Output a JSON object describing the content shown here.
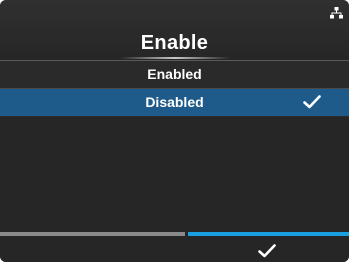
{
  "header": {
    "title": "Enable",
    "status_icon": "network-icon"
  },
  "list": {
    "items": [
      {
        "label": "Enabled",
        "selected": false
      },
      {
        "label": "Disabled",
        "selected": true,
        "icon": "checkmark-icon"
      }
    ]
  },
  "footer": {
    "left_button_label": "",
    "right_button_icon": "checkmark-icon"
  },
  "colors": {
    "selection": "#1e5b8b",
    "confirm_accent": "#1aa0e0",
    "back_accent": "#8a8a8a"
  }
}
